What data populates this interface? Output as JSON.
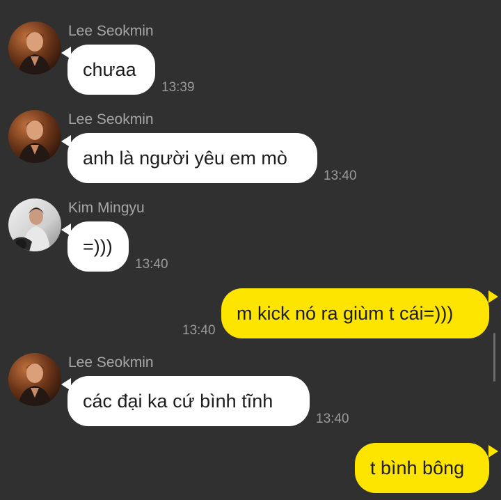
{
  "colors": {
    "background": "#2f302f",
    "incoming_bubble": "#ffffff",
    "outgoing_bubble": "#fee500",
    "sender_name": "#a7a7a7",
    "timestamp": "#9a9a9a"
  },
  "messages": [
    {
      "direction": "incoming",
      "sender": "Lee Seokmin",
      "avatar": "lee-seokmin-avatar",
      "text": "chưaa",
      "time": "13:39"
    },
    {
      "direction": "incoming",
      "sender": "Lee Seokmin",
      "avatar": "lee-seokmin-avatar",
      "text": "anh là người yêu em mò",
      "time": "13:40"
    },
    {
      "direction": "incoming",
      "sender": "Kim Mingyu",
      "avatar": "kim-mingyu-avatar",
      "text": "=)))",
      "time": "13:40"
    },
    {
      "direction": "outgoing",
      "text": "m kick nó ra giùm t cái=)))",
      "time": "13:40"
    },
    {
      "direction": "incoming",
      "sender": "Lee Seokmin",
      "avatar": "lee-seokmin-avatar",
      "text": "các đại ka cứ bình tĩnh",
      "time": "13:40"
    },
    {
      "direction": "outgoing",
      "text": "t bình bông",
      "time": ""
    }
  ]
}
